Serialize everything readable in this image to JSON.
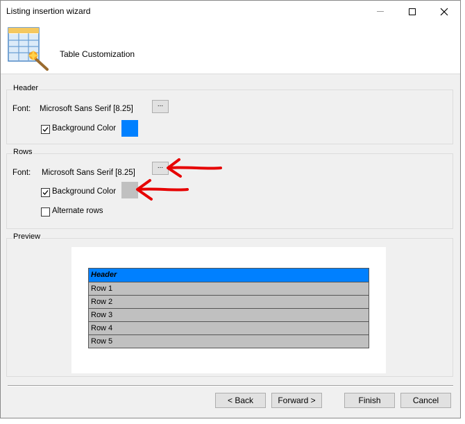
{
  "window": {
    "title": "Listing insertion wizard"
  },
  "wizard": {
    "subtitle": "Table Customization",
    "icon": "table-wizard-icon"
  },
  "header_group": {
    "label": "Header",
    "font_label": "Font:",
    "font_value": "Microsoft Sans Serif [8.25]",
    "font_button": "...",
    "background_label": "Background Color",
    "background_checked": true,
    "background_color": "#0080ff"
  },
  "rows_group": {
    "label": "Rows",
    "font_label": "Font:",
    "font_value": "Microsoft Sans Serif [8.25]",
    "font_button": "...",
    "background_label": "Background Color",
    "background_checked": true,
    "background_color": "#c0c0c0",
    "alternate_label": "Alternate rows",
    "alternate_checked": false
  },
  "preview_group": {
    "label": "Preview",
    "header_cell": "Header",
    "rows": [
      "Row 1",
      "Row 2",
      "Row 3",
      "Row 4",
      "Row 5"
    ]
  },
  "buttons": {
    "back": "< Back",
    "forward": "Forward >",
    "finish": "Finish",
    "cancel": "Cancel"
  },
  "colors": {
    "annotation_arrow": "#e60000"
  }
}
